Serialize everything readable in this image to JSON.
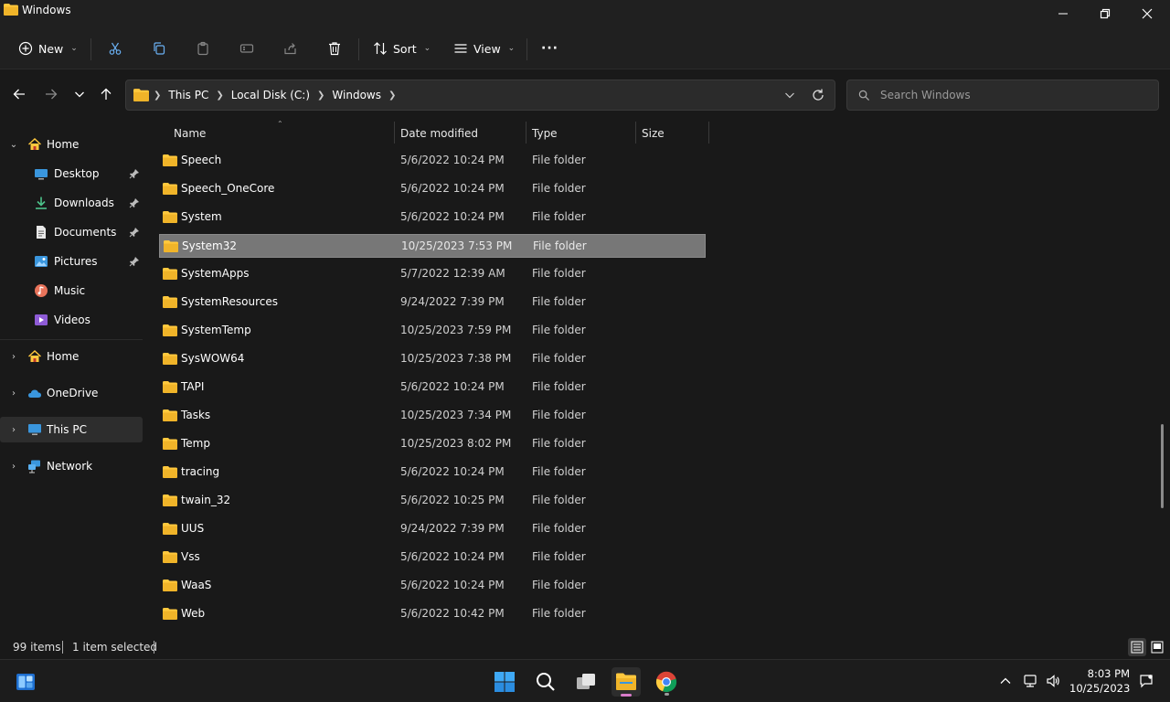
{
  "window": {
    "title": "Windows"
  },
  "commandbar": {
    "new_label": "New",
    "sort_label": "Sort",
    "view_label": "View",
    "more_label": "···"
  },
  "address": {
    "crumbs": [
      "This PC",
      "Local Disk (C:)",
      "Windows"
    ]
  },
  "search": {
    "placeholder": "Search Windows"
  },
  "sidebar": {
    "quick": [
      {
        "label": "Home"
      },
      {
        "label": "Desktop"
      },
      {
        "label": "Downloads"
      },
      {
        "label": "Documents"
      },
      {
        "label": "Pictures"
      },
      {
        "label": "Music"
      },
      {
        "label": "Videos"
      }
    ],
    "roots": [
      {
        "label": "Home"
      },
      {
        "label": "OneDrive"
      },
      {
        "label": "This PC"
      },
      {
        "label": "Network"
      }
    ]
  },
  "columns": {
    "name": "Name",
    "date": "Date modified",
    "type": "Type",
    "size": "Size"
  },
  "files": [
    {
      "name": "Speech",
      "date": "5/6/2022 10:24 PM",
      "type": "File folder"
    },
    {
      "name": "Speech_OneCore",
      "date": "5/6/2022 10:24 PM",
      "type": "File folder"
    },
    {
      "name": "System",
      "date": "5/6/2022 10:24 PM",
      "type": "File folder"
    },
    {
      "name": "System32",
      "date": "10/25/2023 7:53 PM",
      "type": "File folder"
    },
    {
      "name": "SystemApps",
      "date": "5/7/2022 12:39 AM",
      "type": "File folder"
    },
    {
      "name": "SystemResources",
      "date": "9/24/2022 7:39 PM",
      "type": "File folder"
    },
    {
      "name": "SystemTemp",
      "date": "10/25/2023 7:59 PM",
      "type": "File folder"
    },
    {
      "name": "SysWOW64",
      "date": "10/25/2023 7:38 PM",
      "type": "File folder"
    },
    {
      "name": "TAPI",
      "date": "5/6/2022 10:24 PM",
      "type": "File folder"
    },
    {
      "name": "Tasks",
      "date": "10/25/2023 7:34 PM",
      "type": "File folder"
    },
    {
      "name": "Temp",
      "date": "10/25/2023 8:02 PM",
      "type": "File folder"
    },
    {
      "name": "tracing",
      "date": "5/6/2022 10:24 PM",
      "type": "File folder"
    },
    {
      "name": "twain_32",
      "date": "5/6/2022 10:25 PM",
      "type": "File folder"
    },
    {
      "name": "UUS",
      "date": "9/24/2022 7:39 PM",
      "type": "File folder"
    },
    {
      "name": "Vss",
      "date": "5/6/2022 10:24 PM",
      "type": "File folder"
    },
    {
      "name": "WaaS",
      "date": "5/6/2022 10:24 PM",
      "type": "File folder"
    },
    {
      "name": "Web",
      "date": "5/6/2022 10:42 PM",
      "type": "File folder"
    }
  ],
  "selected_file": "System32",
  "status": {
    "count": "99 items",
    "selection": "1 item selected"
  },
  "clock": {
    "time": "8:03 PM",
    "date": "10/25/2023"
  },
  "colors": {
    "accent": "#ffc83d",
    "selection": "#777777",
    "background": "#191919"
  }
}
